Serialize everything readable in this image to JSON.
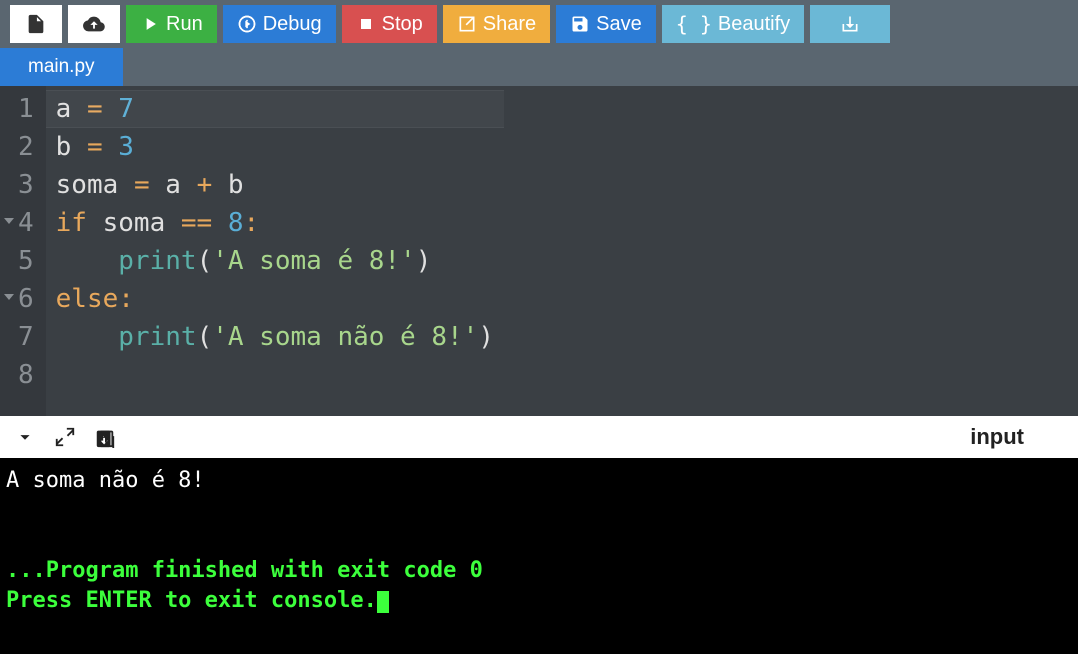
{
  "toolbar": {
    "run": "Run",
    "debug": "Debug",
    "stop": "Stop",
    "share": "Share",
    "save": "Save",
    "beautify": "Beautify"
  },
  "tabs": {
    "active": "main.py"
  },
  "code": {
    "lines": [
      {
        "num": "1",
        "fold": false,
        "tokens": [
          {
            "t": "a",
            "c": "var"
          },
          {
            "t": " ",
            "c": ""
          },
          {
            "t": "=",
            "c": "op"
          },
          {
            "t": " ",
            "c": ""
          },
          {
            "t": "7",
            "c": "num"
          }
        ]
      },
      {
        "num": "2",
        "fold": false,
        "tokens": [
          {
            "t": "b",
            "c": "var"
          },
          {
            "t": " ",
            "c": ""
          },
          {
            "t": "=",
            "c": "op"
          },
          {
            "t": " ",
            "c": ""
          },
          {
            "t": "3",
            "c": "num"
          }
        ]
      },
      {
        "num": "3",
        "fold": false,
        "tokens": [
          {
            "t": "soma",
            "c": "var"
          },
          {
            "t": " ",
            "c": ""
          },
          {
            "t": "=",
            "c": "op"
          },
          {
            "t": " ",
            "c": ""
          },
          {
            "t": "a",
            "c": "var"
          },
          {
            "t": " ",
            "c": ""
          },
          {
            "t": "+",
            "c": "op"
          },
          {
            "t": " ",
            "c": ""
          },
          {
            "t": "b",
            "c": "var"
          }
        ]
      },
      {
        "num": "4",
        "fold": true,
        "tokens": [
          {
            "t": "if",
            "c": "kw"
          },
          {
            "t": " ",
            "c": ""
          },
          {
            "t": "soma",
            "c": "var"
          },
          {
            "t": " ",
            "c": ""
          },
          {
            "t": "==",
            "c": "op"
          },
          {
            "t": " ",
            "c": ""
          },
          {
            "t": "8",
            "c": "num"
          },
          {
            "t": ":",
            "c": "op"
          }
        ]
      },
      {
        "num": "5",
        "fold": false,
        "tokens": [
          {
            "t": "    ",
            "c": ""
          },
          {
            "t": "print",
            "c": "func"
          },
          {
            "t": "(",
            "c": "paren"
          },
          {
            "t": "'A soma é 8!'",
            "c": "str"
          },
          {
            "t": ")",
            "c": "paren"
          }
        ]
      },
      {
        "num": "6",
        "fold": true,
        "tokens": [
          {
            "t": "else",
            "c": "kw"
          },
          {
            "t": ":",
            "c": "op"
          }
        ]
      },
      {
        "num": "7",
        "fold": false,
        "tokens": [
          {
            "t": "    ",
            "c": ""
          },
          {
            "t": "print",
            "c": "func"
          },
          {
            "t": "(",
            "c": "paren"
          },
          {
            "t": "'A soma não é 8!'",
            "c": "str"
          },
          {
            "t": ")",
            "c": "paren"
          }
        ]
      },
      {
        "num": "8",
        "fold": false,
        "tokens": []
      }
    ]
  },
  "console_toolbar": {
    "input_label": "input"
  },
  "console": {
    "lines": [
      {
        "text": "A soma não é 8!",
        "style": "white"
      },
      {
        "text": "",
        "style": "white"
      },
      {
        "text": "",
        "style": "white"
      },
      {
        "text": "...Program finished with exit code 0",
        "style": "green"
      },
      {
        "text": "Press ENTER to exit console.",
        "style": "green",
        "cursor": true
      }
    ]
  }
}
